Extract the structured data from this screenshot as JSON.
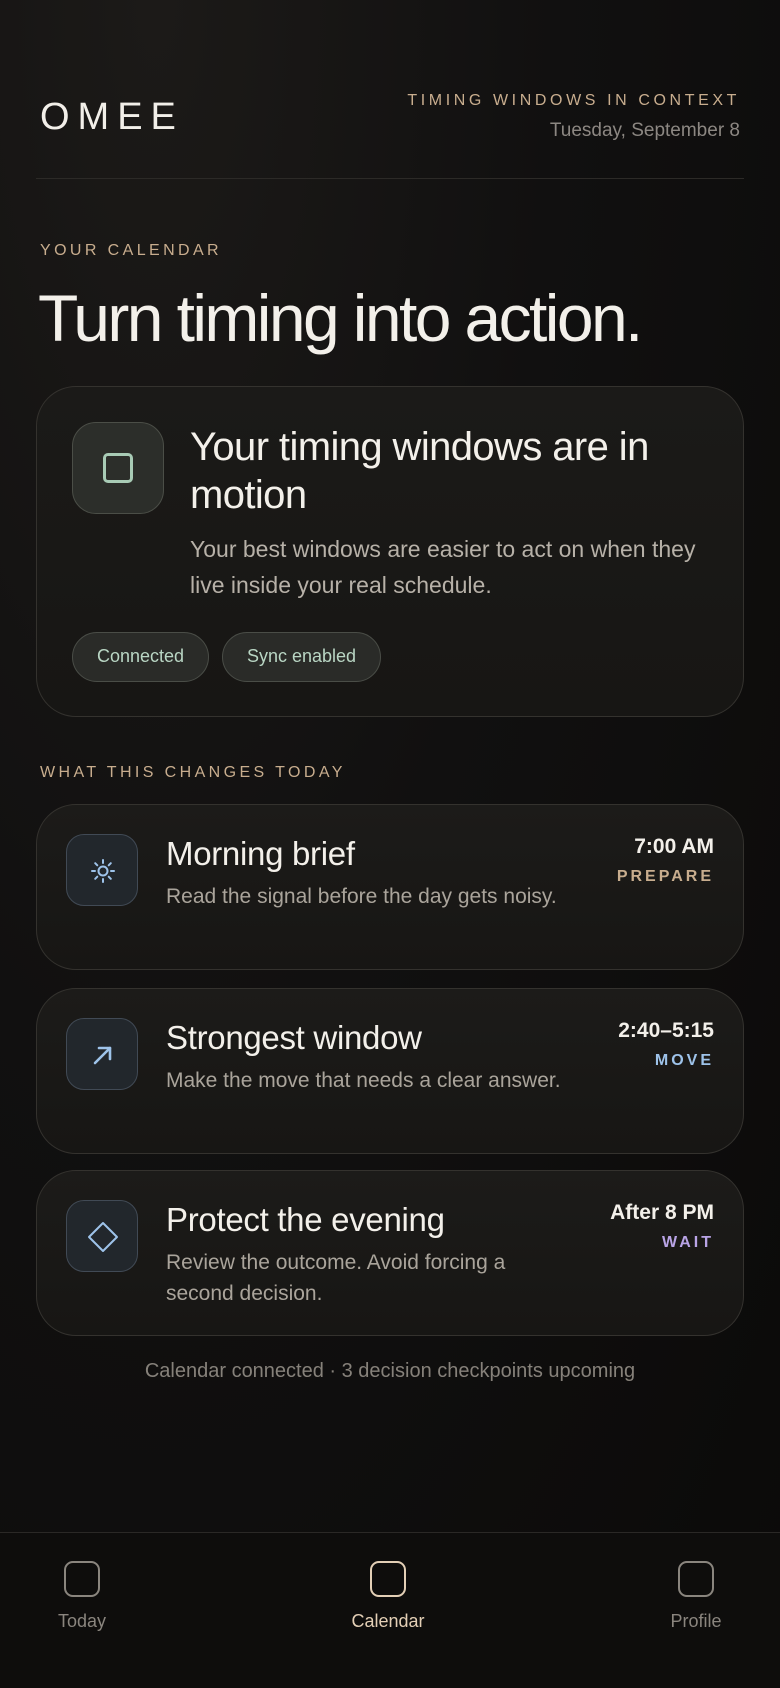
{
  "header": {
    "logo": "OMEE",
    "tagline": "TIMING WINDOWS IN CONTEXT",
    "date": "Tuesday, September 8"
  },
  "calendar_section": {
    "label": "YOUR CALENDAR",
    "headline": "Turn timing into action."
  },
  "status_card": {
    "icon": "square-icon",
    "title": "Your timing windows are in motion",
    "description": "Your best windows are easier to act on when they live inside your real schedule.",
    "pills": [
      "Connected",
      "Sync enabled"
    ]
  },
  "changes_section": {
    "label": "WHAT THIS CHANGES TODAY",
    "events": [
      {
        "icon": "sun-icon",
        "title": "Morning brief",
        "description": "Read the signal before the day gets noisy.",
        "time": "7:00 AM",
        "tag": "PREPARE",
        "tag_color": "#c8ad8e"
      },
      {
        "icon": "arrow-up-right-icon",
        "title": "Strongest window",
        "description": "Make the move that needs a clear answer.",
        "time": "2:40–5:15",
        "tag": "MOVE",
        "tag_color": "#9ec3ea"
      },
      {
        "icon": "diamond-icon",
        "title": "Protect the evening",
        "description": "Review the outcome. Avoid forcing a second decision.",
        "time": "After 8 PM",
        "tag": "WAIT",
        "tag_color": "#b9a4e6"
      }
    ]
  },
  "footer_status": "Calendar connected · 3 decision checkpoints upcoming",
  "nav": {
    "items": [
      {
        "label": "Today",
        "active": false
      },
      {
        "label": "Calendar",
        "active": true
      },
      {
        "label": "Profile",
        "active": false
      }
    ]
  },
  "colors": {
    "accent": "#c8ad8e",
    "active_nav": "#e3cfb6",
    "background": "#0d0c0b"
  }
}
